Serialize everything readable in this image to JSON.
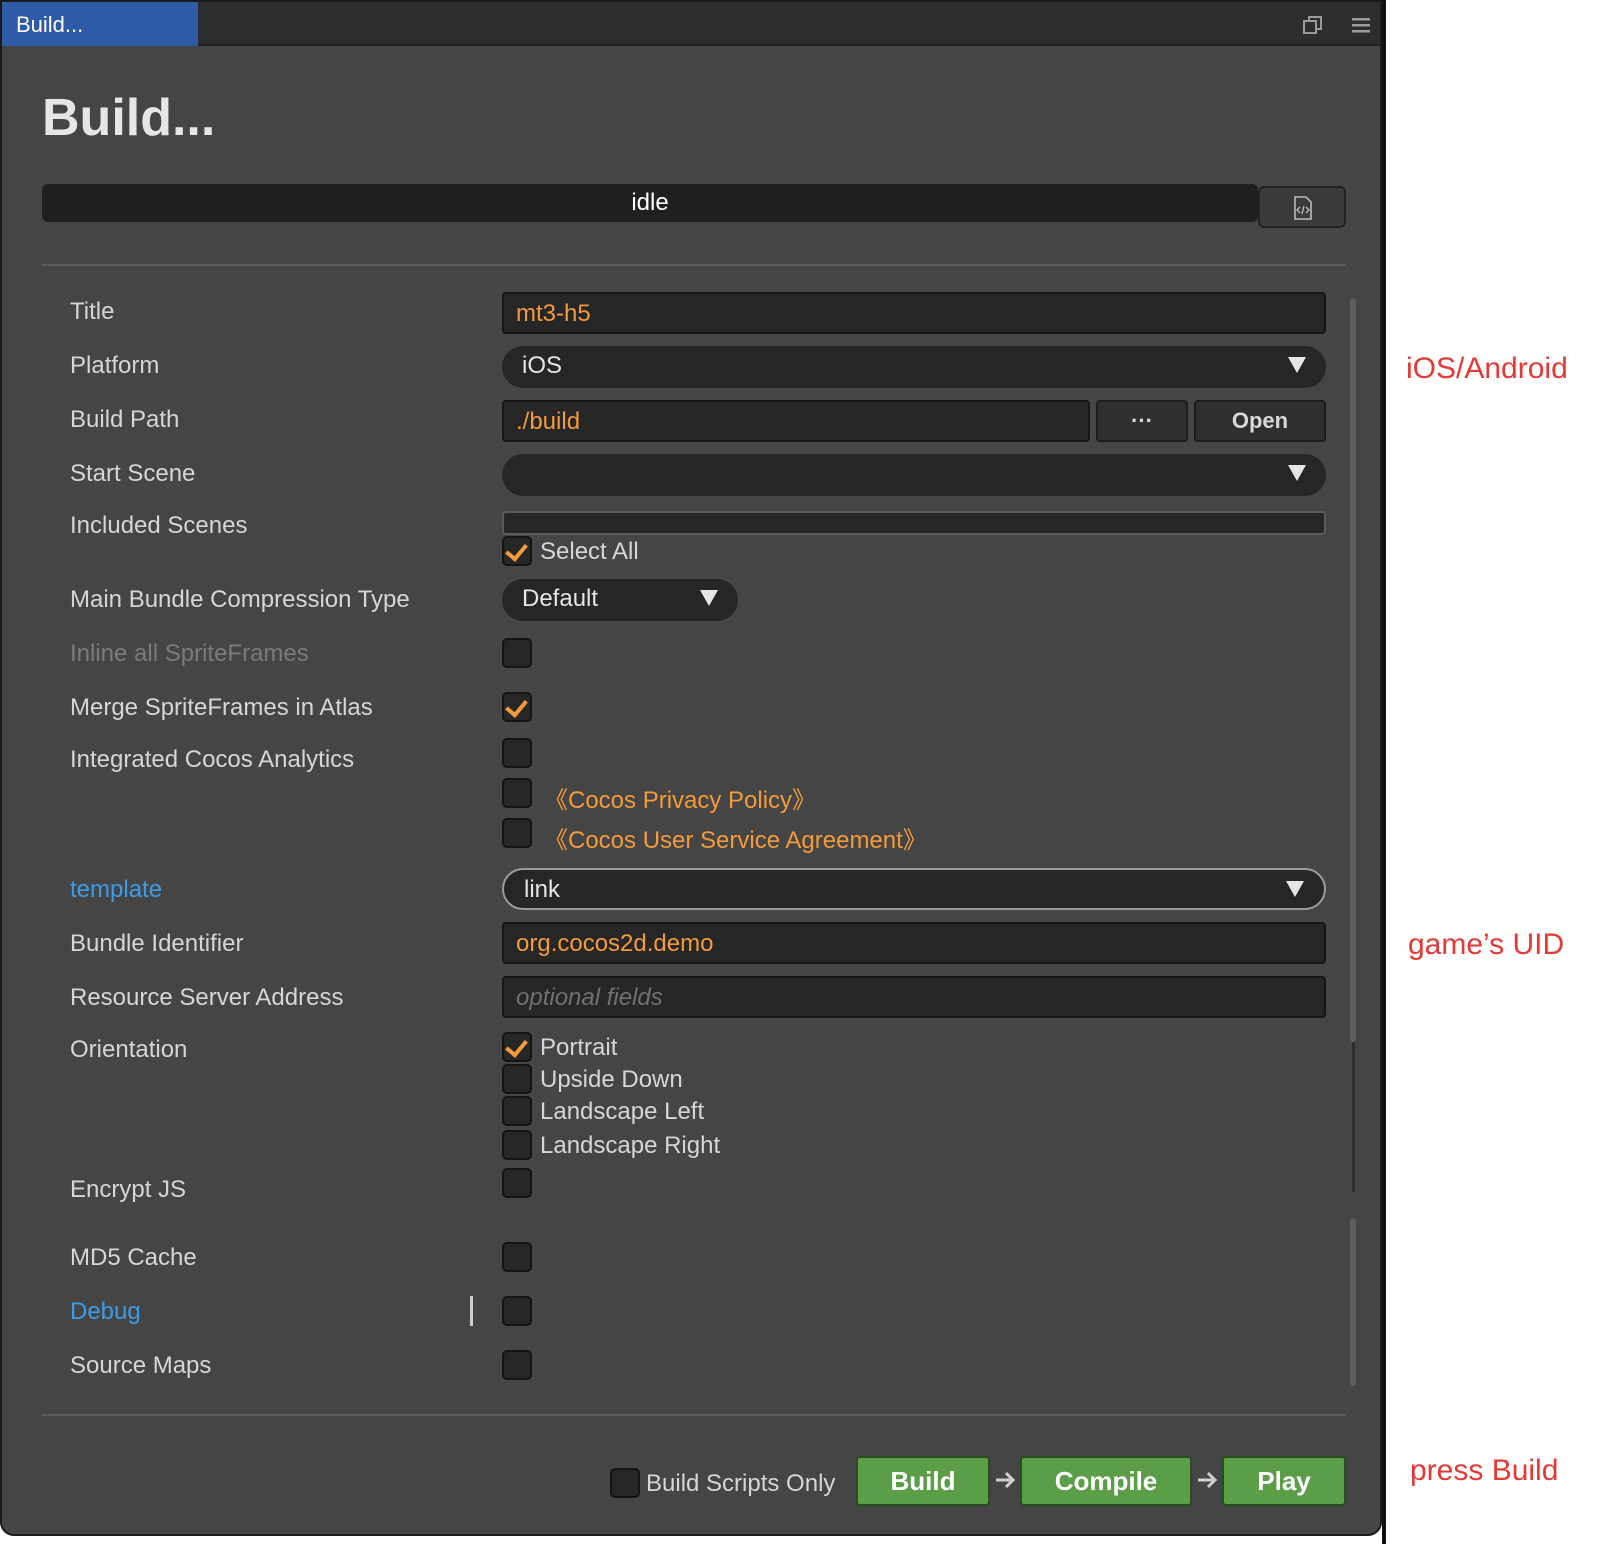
{
  "window": {
    "tab_title": "Build...",
    "heading": "Build...",
    "status": "idle"
  },
  "form": {
    "title": {
      "label": "Title",
      "value": "mt3-h5"
    },
    "platform": {
      "label": "Platform",
      "value": "iOS"
    },
    "build_path": {
      "label": "Build Path",
      "value": "./build",
      "browse_label": "···",
      "open_label": "Open"
    },
    "start_scene": {
      "label": "Start Scene",
      "value": ""
    },
    "included_scenes": {
      "label": "Included Scenes",
      "select_all_label": "Select All",
      "select_all_checked": true
    },
    "compression": {
      "label": "Main Bundle Compression Type",
      "value": "Default"
    },
    "inline_spriteframes": {
      "label": "Inline all SpriteFrames",
      "checked": false
    },
    "merge_spriteframes": {
      "label": "Merge SpriteFrames in Atlas",
      "checked": true
    },
    "analytics": {
      "label": "Integrated Cocos Analytics",
      "checked": false,
      "privacy_label": "《Cocos Privacy Policy》",
      "agreement_label": "《Cocos User Service Agreement》"
    },
    "template": {
      "label": "template",
      "value": "link"
    },
    "bundle_identifier": {
      "label": "Bundle Identifier",
      "value": "org.cocos2d.demo"
    },
    "resource_server": {
      "label": "Resource Server Address",
      "placeholder": "optional fields",
      "value": ""
    },
    "orientation": {
      "label": "Orientation",
      "options": [
        {
          "label": "Portrait",
          "checked": true
        },
        {
          "label": "Upside Down",
          "checked": false
        },
        {
          "label": "Landscape Left",
          "checked": false
        },
        {
          "label": "Landscape Right",
          "checked": false
        }
      ]
    },
    "encrypt_js": {
      "label": "Encrypt JS",
      "checked": false
    },
    "md5_cache": {
      "label": "MD5 Cache",
      "checked": false
    },
    "debug": {
      "label": "Debug",
      "checked": false
    },
    "source_maps": {
      "label": "Source Maps",
      "checked": false
    }
  },
  "footer": {
    "build_scripts_only_label": "Build Scripts Only",
    "build_label": "Build",
    "compile_label": "Compile",
    "play_label": "Play"
  },
  "annotations": {
    "platform_note": "iOS/Android",
    "uid_note": "game’s UID",
    "build_note": "press Build"
  },
  "colors": {
    "accent_orange": "#f39b3a",
    "link_blue": "#3d9be6",
    "action_green": "#5c9e48",
    "annotation_red": "#e53935",
    "tab_blue": "#2d5ba7"
  }
}
